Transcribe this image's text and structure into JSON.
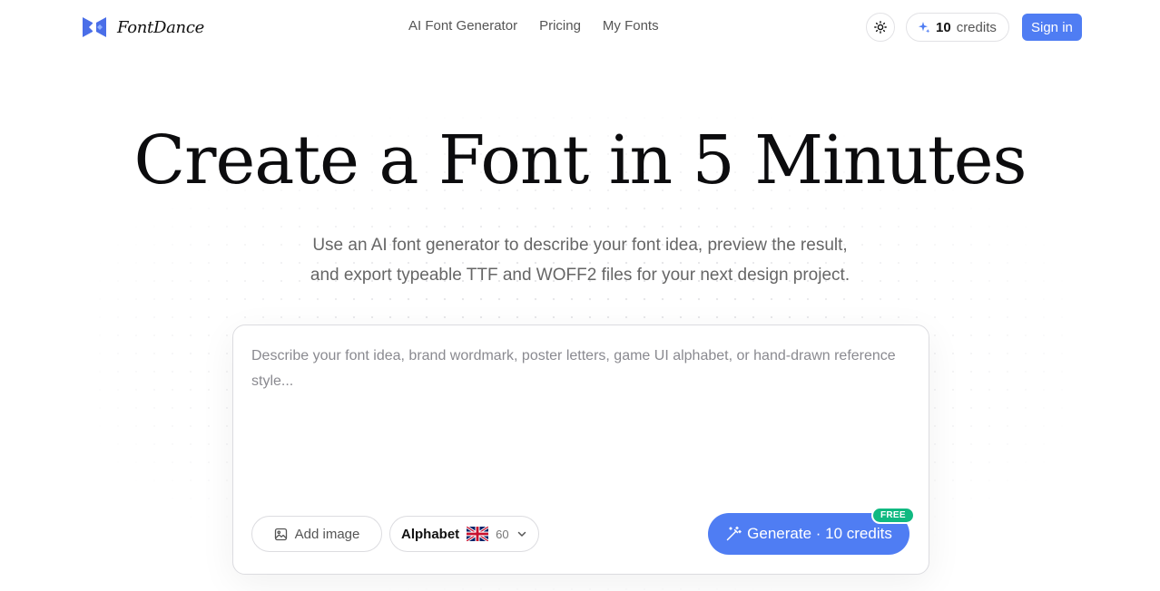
{
  "header": {
    "brand": "FontDance",
    "nav": [
      {
        "label": "AI Font Generator"
      },
      {
        "label": "Pricing"
      },
      {
        "label": "My Fonts"
      }
    ],
    "theme_icon": "sun-icon",
    "credits": {
      "icon": "sparkles-icon",
      "count": "10",
      "label": "credits"
    },
    "signin_label": "Sign in"
  },
  "hero": {
    "title": "Create a Font in 5 Minutes",
    "subtitle_line1": "Use an AI font generator to describe your font idea, preview the result,",
    "subtitle_line2": "and export typeable TTF and WOFF2 files for your next design project."
  },
  "composer": {
    "prompt_value": "",
    "prompt_placeholder": "Describe your font idea, brand wordmark, poster letters, game UI alphabet, or hand-drawn reference style...",
    "add_image_label": "Add image",
    "charset": {
      "name": "Alphabet",
      "flag": "uk-flag-icon",
      "count": "60"
    },
    "generate_label": "Generate · 10 credits",
    "badge": "FREE"
  },
  "colors": {
    "accent": "#4f7df3",
    "badge": "#10b981",
    "text": "#0c0c0e",
    "muted": "#666666"
  }
}
